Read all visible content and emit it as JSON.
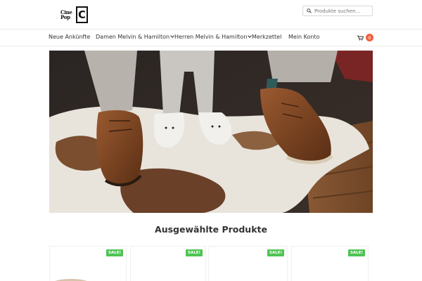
{
  "header": {
    "logo_text": "Cine Pop",
    "logo_letter": "C",
    "search_placeholder": "Produkte suchen…"
  },
  "nav": {
    "items": [
      {
        "label": "Neue Ankünfte"
      },
      {
        "label": "Damen Melvin & Hamilton"
      },
      {
        "label": "Herren Melvin & Hamilton"
      },
      {
        "label": "Merkzettel"
      },
      {
        "label": "Mein Konto"
      }
    ],
    "cart_count": "0"
  },
  "section": {
    "title": "Ausgewählte Produkte"
  },
  "products": [
    {
      "badge": "SALE!"
    },
    {
      "badge": "SALE!"
    },
    {
      "badge": "SALE!"
    },
    {
      "badge": "SALE!"
    }
  ],
  "colors": {
    "sale_badge": "#4ec454",
    "cart_badge": "#f0603c"
  },
  "icons": {
    "search": "search-icon",
    "cart": "cart-icon"
  }
}
